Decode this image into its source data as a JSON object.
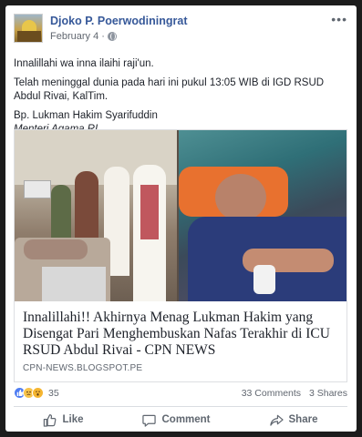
{
  "post": {
    "author": "Djoko P. Poerwodiningrat",
    "date": "February 4",
    "date_separator": "·",
    "privacy_icon": "globe-icon",
    "more_icon": "ellipsis-icon",
    "more_label": "•••",
    "paragraphs": [
      "Innalillahi wa inna ilaihi raji'un.",
      "Telah meninggal dunia pada hari ini pukul 13:05 WIB di IGD RSUD Abdul Rivai, KalTim."
    ],
    "signature_name": "Bp. Lukman Hakim Syarifuddin",
    "signature_title": "Menteri Agama RI"
  },
  "link_preview": {
    "title": "Innalillahi!! Akhirnya Menag Lukman Hakim yang Disengat Pari Menghembuskan Nafas Terakhir di ICU RSUD Abdul Rivai - CPN NEWS",
    "domain": "CPN-NEWS.BLOGSPOT.PE"
  },
  "stats": {
    "reaction_icons": [
      "like-reaction-icon",
      "sad-reaction-icon",
      "wow-reaction-icon"
    ],
    "reaction_count": "35",
    "comments": "33 Comments",
    "shares": "3 Shares"
  },
  "actions": {
    "like": "Like",
    "comment": "Comment",
    "share": "Share"
  },
  "colors": {
    "author_link": "#365899",
    "meta_text": "#616770",
    "like_reaction": "#4f7df2",
    "sad_reaction": "#f7c34a"
  }
}
